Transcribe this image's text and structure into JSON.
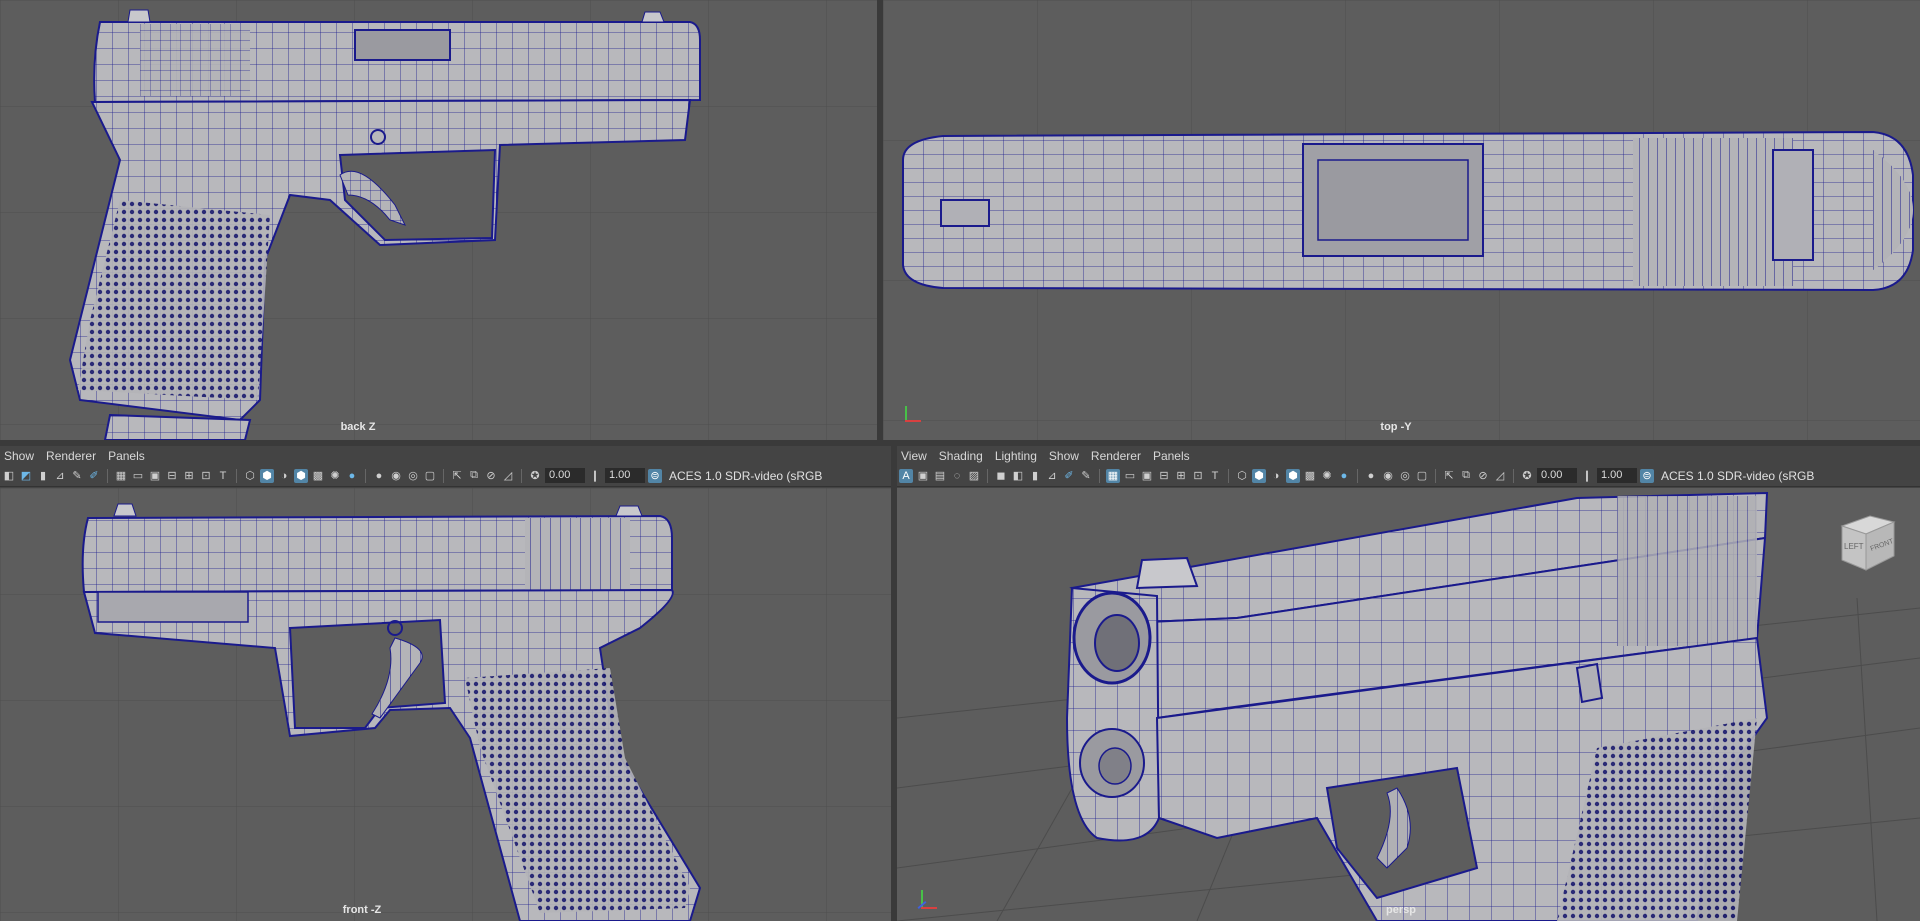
{
  "viewports": {
    "back": {
      "label": "back Z"
    },
    "top": {
      "label": "top -Y"
    },
    "front": {
      "label": "front -Z"
    },
    "persp": {
      "label": "persp"
    }
  },
  "left_panel": {
    "menu": {
      "show": "Show",
      "renderer": "Renderer",
      "panels": "Panels"
    },
    "exposure": "0.00",
    "gamma": "1.00",
    "color_space": "ACES 1.0 SDR-video (sRGB"
  },
  "right_panel": {
    "menu": {
      "view": "View",
      "shading": "Shading",
      "lighting": "Lighting",
      "show": "Show",
      "renderer": "Renderer",
      "panels": "Panels"
    },
    "exposure": "0.00",
    "gamma": "1.00",
    "color_space": "ACES 1.0 SDR-video (sRGB"
  },
  "view_cube": {
    "left": "LEFT",
    "front": "FRONT"
  },
  "colors": {
    "wire": "#1a1a8c",
    "mesh": "#b8b8bc",
    "viewport_bg": "#5d5d5d",
    "grid": "#4e4e4e"
  }
}
